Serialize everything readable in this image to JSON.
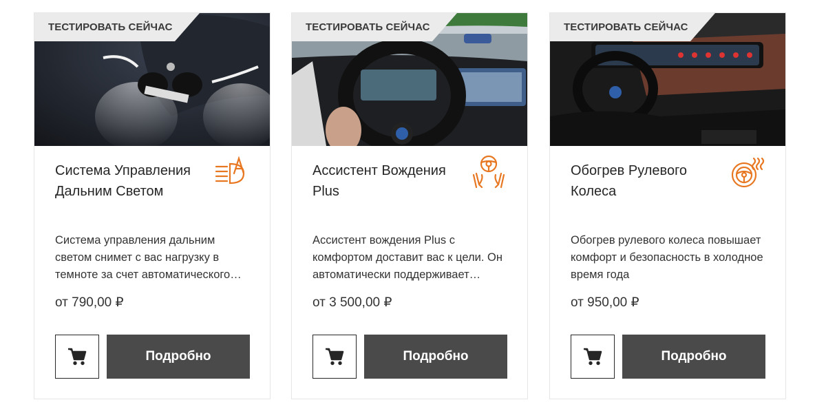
{
  "colors": {
    "accent": "#e87722",
    "button_dark": "#4a4a4a",
    "badge_bg": "#ebebeb"
  },
  "cards": [
    {
      "badge": "ТЕСТИРОВАТЬ СЕЙЧАС",
      "title": "Система Управления Дальним Светом",
      "icon": "high-beam-icon",
      "description": "Система управления дальним светом снимет с вас нагрузку в темноте за счет автоматического переключения",
      "price": "от 790,00 ₽",
      "details_label": "Подробно",
      "cart_icon": "cart-icon"
    },
    {
      "badge": "ТЕСТИРОВАТЬ СЕЙЧАС",
      "title": "Ассистент Вождения Plus",
      "icon": "driving-assistant-icon",
      "description": "Ассистент вождения Plus с комфортом доставит вас к цели. Он автоматически поддерживает дистанцию",
      "price": "от 3 500,00 ₽",
      "details_label": "Подробно",
      "cart_icon": "cart-icon"
    },
    {
      "badge": "ТЕСТИРОВАТЬ СЕЙЧАС",
      "title": "Обогрев Рулевого Колеса",
      "icon": "heated-steering-wheel-icon",
      "description": "Обогрев рулевого колеса повышает комфорт и безопасность в холодное время года",
      "price": "от 950,00 ₽",
      "details_label": "Подробно",
      "cart_icon": "cart-icon"
    }
  ]
}
